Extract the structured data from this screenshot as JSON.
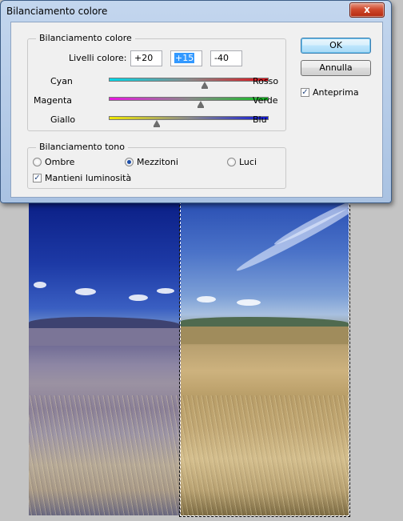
{
  "dialog": {
    "title": "Bilanciamento colore",
    "close_glyph": "x",
    "color_balance": {
      "legend": "Bilanciamento colore",
      "levels_label": "Livelli colore:",
      "levels": [
        "+20",
        "+15",
        "-40"
      ],
      "sliders": [
        {
          "left": "Cyan",
          "right": "Rosso",
          "value": 20,
          "colors": [
            "#00d8e8",
            "#e01018"
          ]
        },
        {
          "left": "Magenta",
          "right": "Verde",
          "value": 15,
          "colors": [
            "#e818e0",
            "#10c020"
          ]
        },
        {
          "left": "Giallo",
          "right": "Blu",
          "value": -40,
          "colors": [
            "#f0e800",
            "#1018d8"
          ]
        }
      ]
    },
    "tone_balance": {
      "legend": "Bilanciamento tono",
      "options": [
        "Ombre",
        "Mezzitoni",
        "Luci"
      ],
      "selected": "Mezzitoni",
      "preserve_luminosity": {
        "label": "Mantieni luminosità",
        "checked": true
      }
    },
    "buttons": {
      "ok": "OK",
      "cancel": "Annulla"
    },
    "preview": {
      "label": "Anteprima",
      "checked": true
    }
  }
}
